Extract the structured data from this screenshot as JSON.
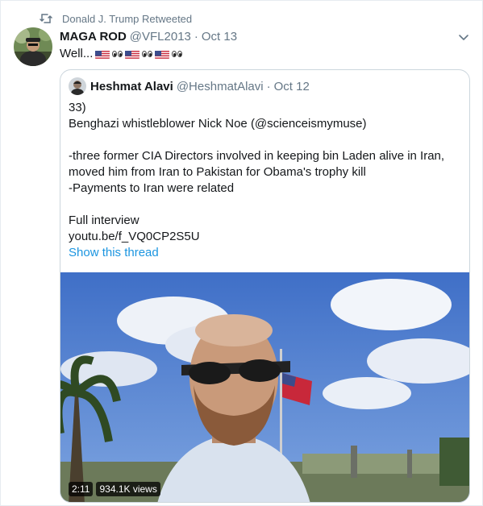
{
  "retweet": {
    "label": "Donald J. Trump Retweeted",
    "icon": "retweet-icon"
  },
  "tweet": {
    "display_name": "MAGA ROD",
    "handle": "@VFL2013",
    "separator": "·",
    "date": "Oct 13",
    "text": "Well...",
    "emoji_sequence": [
      "us-flag",
      "eyes",
      "us-flag",
      "eyes",
      "us-flag",
      "eyes"
    ]
  },
  "quote": {
    "display_name": "Heshmat Alavi",
    "handle": "@HeshmatAlavi",
    "separator": "·",
    "date": "Oct 12",
    "lines": [
      "33)",
      "Benghazi whistleblower Nick Noe (@scienceismymuse)",
      "",
      "-three former CIA Directors involved in keeping bin Laden alive in Iran,",
      "moved him from Iran to Pakistan for Obama's trophy kill",
      "-Payments to Iran were related",
      "",
      "Full interview",
      "youtu.be/f_VQ0CP2S5U"
    ],
    "show_thread": "Show this thread"
  },
  "video": {
    "duration": "2:11",
    "views": "934.1K views"
  },
  "colors": {
    "link": "#1b95e0",
    "muted": "#657786",
    "border": "#ccd6dd",
    "text": "#14171a"
  }
}
